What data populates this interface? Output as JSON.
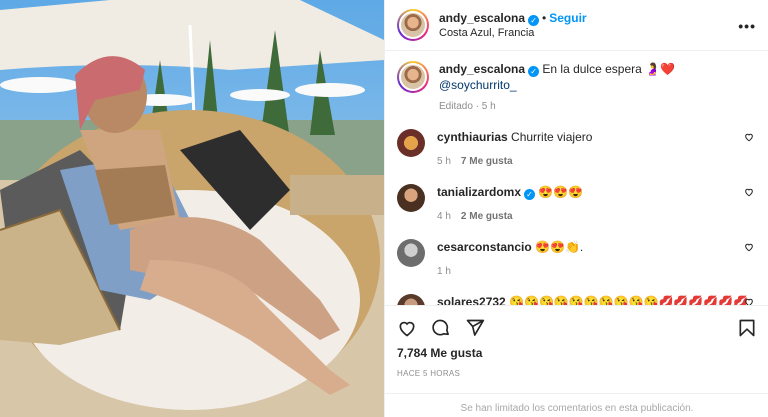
{
  "post": {
    "username": "andy_escalona",
    "follow_label": "Seguir",
    "location": "Costa Azul, Francia",
    "more_label": "•••"
  },
  "caption": {
    "username": "andy_escalona",
    "text": "En la dulce espera 🤰❤️",
    "mention": "@soychurrito_",
    "edited": "Editado · 5 h"
  },
  "comments": [
    {
      "username": "cynthiaurias",
      "text": "Churrite viajero",
      "time": "5 h",
      "likes": "7 Me gusta"
    },
    {
      "username": "tanializardomx",
      "text": "😍😍😍",
      "time": "4 h",
      "likes": "2 Me gusta"
    },
    {
      "username": "cesarconstancio",
      "text": "😍😍👏.",
      "time": "1 h",
      "likes": ""
    },
    {
      "username": "solares2732",
      "text": "😘😘😘😘😘😘😘😘😘😘💋💋💋💋💋💋",
      "time": "",
      "likes": ""
    }
  ],
  "stats": {
    "likes": "7,784 Me gusta",
    "time_ago": "HACE 5 HORAS",
    "comments_limited": "Se han limitado los comentarios en esta publicación."
  },
  "colors": {
    "accent": "#0095f6",
    "text": "#262626",
    "muted": "#8e8e8e",
    "heart_outline": "#262626"
  }
}
